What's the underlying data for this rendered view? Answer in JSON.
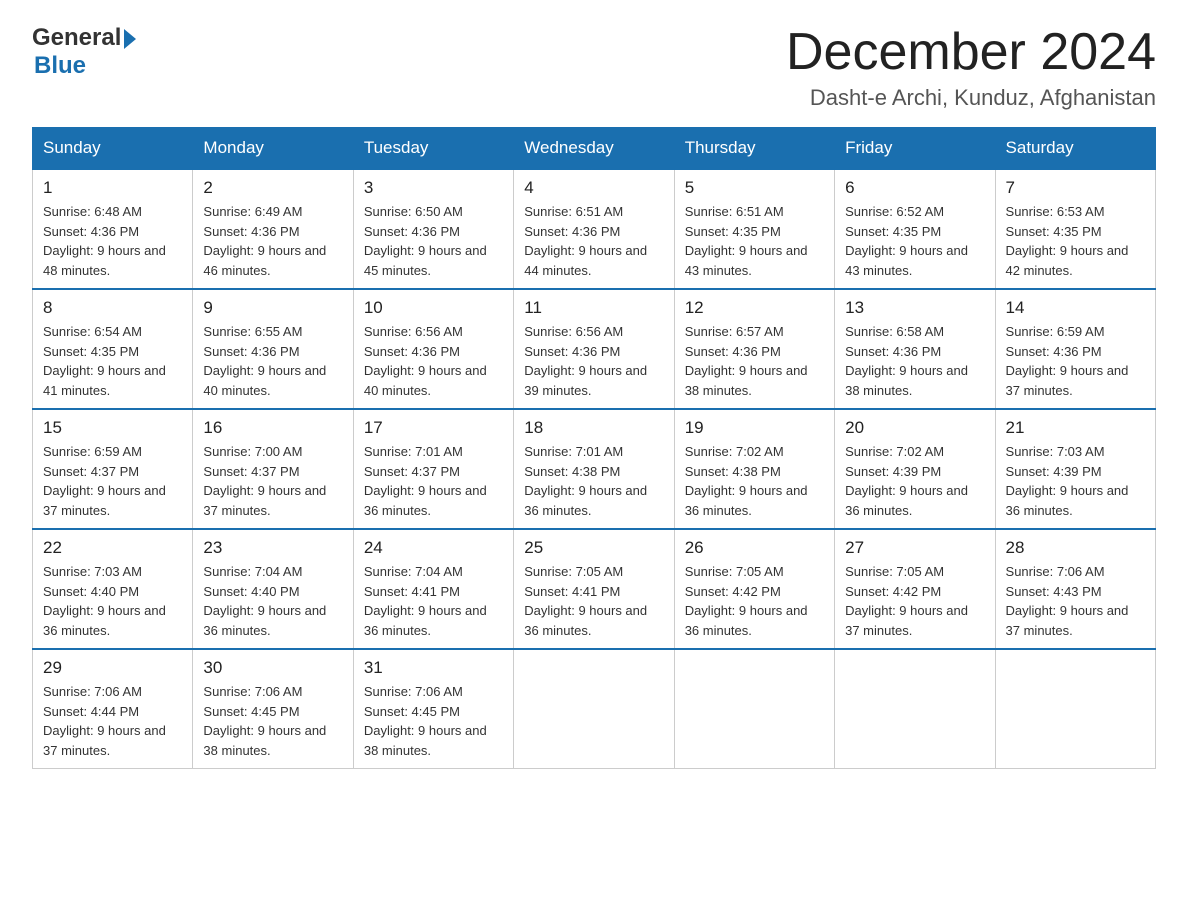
{
  "header": {
    "logo_general": "General",
    "logo_blue": "Blue",
    "month_title": "December 2024",
    "location": "Dasht-e Archi, Kunduz, Afghanistan"
  },
  "weekdays": [
    "Sunday",
    "Monday",
    "Tuesday",
    "Wednesday",
    "Thursday",
    "Friday",
    "Saturday"
  ],
  "weeks": [
    [
      {
        "day": "1",
        "sunrise": "6:48 AM",
        "sunset": "4:36 PM",
        "daylight": "9 hours and 48 minutes."
      },
      {
        "day": "2",
        "sunrise": "6:49 AM",
        "sunset": "4:36 PM",
        "daylight": "9 hours and 46 minutes."
      },
      {
        "day": "3",
        "sunrise": "6:50 AM",
        "sunset": "4:36 PM",
        "daylight": "9 hours and 45 minutes."
      },
      {
        "day": "4",
        "sunrise": "6:51 AM",
        "sunset": "4:36 PM",
        "daylight": "9 hours and 44 minutes."
      },
      {
        "day": "5",
        "sunrise": "6:51 AM",
        "sunset": "4:35 PM",
        "daylight": "9 hours and 43 minutes."
      },
      {
        "day": "6",
        "sunrise": "6:52 AM",
        "sunset": "4:35 PM",
        "daylight": "9 hours and 43 minutes."
      },
      {
        "day": "7",
        "sunrise": "6:53 AM",
        "sunset": "4:35 PM",
        "daylight": "9 hours and 42 minutes."
      }
    ],
    [
      {
        "day": "8",
        "sunrise": "6:54 AM",
        "sunset": "4:35 PM",
        "daylight": "9 hours and 41 minutes."
      },
      {
        "day": "9",
        "sunrise": "6:55 AM",
        "sunset": "4:36 PM",
        "daylight": "9 hours and 40 minutes."
      },
      {
        "day": "10",
        "sunrise": "6:56 AM",
        "sunset": "4:36 PM",
        "daylight": "9 hours and 40 minutes."
      },
      {
        "day": "11",
        "sunrise": "6:56 AM",
        "sunset": "4:36 PM",
        "daylight": "9 hours and 39 minutes."
      },
      {
        "day": "12",
        "sunrise": "6:57 AM",
        "sunset": "4:36 PM",
        "daylight": "9 hours and 38 minutes."
      },
      {
        "day": "13",
        "sunrise": "6:58 AM",
        "sunset": "4:36 PM",
        "daylight": "9 hours and 38 minutes."
      },
      {
        "day": "14",
        "sunrise": "6:59 AM",
        "sunset": "4:36 PM",
        "daylight": "9 hours and 37 minutes."
      }
    ],
    [
      {
        "day": "15",
        "sunrise": "6:59 AM",
        "sunset": "4:37 PM",
        "daylight": "9 hours and 37 minutes."
      },
      {
        "day": "16",
        "sunrise": "7:00 AM",
        "sunset": "4:37 PM",
        "daylight": "9 hours and 37 minutes."
      },
      {
        "day": "17",
        "sunrise": "7:01 AM",
        "sunset": "4:37 PM",
        "daylight": "9 hours and 36 minutes."
      },
      {
        "day": "18",
        "sunrise": "7:01 AM",
        "sunset": "4:38 PM",
        "daylight": "9 hours and 36 minutes."
      },
      {
        "day": "19",
        "sunrise": "7:02 AM",
        "sunset": "4:38 PM",
        "daylight": "9 hours and 36 minutes."
      },
      {
        "day": "20",
        "sunrise": "7:02 AM",
        "sunset": "4:39 PM",
        "daylight": "9 hours and 36 minutes."
      },
      {
        "day": "21",
        "sunrise": "7:03 AM",
        "sunset": "4:39 PM",
        "daylight": "9 hours and 36 minutes."
      }
    ],
    [
      {
        "day": "22",
        "sunrise": "7:03 AM",
        "sunset": "4:40 PM",
        "daylight": "9 hours and 36 minutes."
      },
      {
        "day": "23",
        "sunrise": "7:04 AM",
        "sunset": "4:40 PM",
        "daylight": "9 hours and 36 minutes."
      },
      {
        "day": "24",
        "sunrise": "7:04 AM",
        "sunset": "4:41 PM",
        "daylight": "9 hours and 36 minutes."
      },
      {
        "day": "25",
        "sunrise": "7:05 AM",
        "sunset": "4:41 PM",
        "daylight": "9 hours and 36 minutes."
      },
      {
        "day": "26",
        "sunrise": "7:05 AM",
        "sunset": "4:42 PM",
        "daylight": "9 hours and 36 minutes."
      },
      {
        "day": "27",
        "sunrise": "7:05 AM",
        "sunset": "4:42 PM",
        "daylight": "9 hours and 37 minutes."
      },
      {
        "day": "28",
        "sunrise": "7:06 AM",
        "sunset": "4:43 PM",
        "daylight": "9 hours and 37 minutes."
      }
    ],
    [
      {
        "day": "29",
        "sunrise": "7:06 AM",
        "sunset": "4:44 PM",
        "daylight": "9 hours and 37 minutes."
      },
      {
        "day": "30",
        "sunrise": "7:06 AM",
        "sunset": "4:45 PM",
        "daylight": "9 hours and 38 minutes."
      },
      {
        "day": "31",
        "sunrise": "7:06 AM",
        "sunset": "4:45 PM",
        "daylight": "9 hours and 38 minutes."
      },
      null,
      null,
      null,
      null
    ]
  ]
}
